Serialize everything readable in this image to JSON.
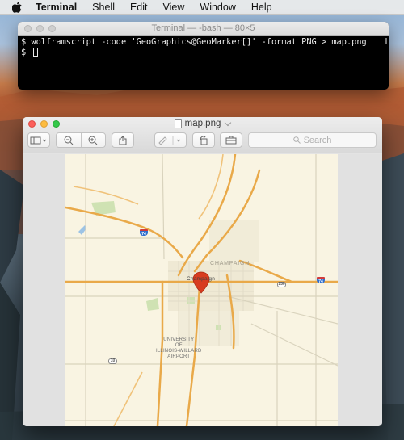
{
  "menubar": {
    "items": [
      "Terminal",
      "Shell",
      "Edit",
      "View",
      "Window",
      "Help"
    ]
  },
  "terminal": {
    "title": "Terminal — -bash — 80×5",
    "line1": "$ wolframscript -code 'GeoGraphics@GeoMarker[]' -format PNG > map.png",
    "line2": "$ "
  },
  "preview": {
    "title": "map.png",
    "search_placeholder": "Search",
    "map_labels": {
      "champaign": "CHAMPAIGN",
      "champaign_downtown": "Champaign",
      "university": "UNIVERSITY\nOF\nILLINOIS-WILLARD\nAIRPORT"
    },
    "shields": {
      "i74_a": "74",
      "i74_b": "74",
      "i57": "57",
      "us150": "150",
      "us10": "10"
    }
  }
}
